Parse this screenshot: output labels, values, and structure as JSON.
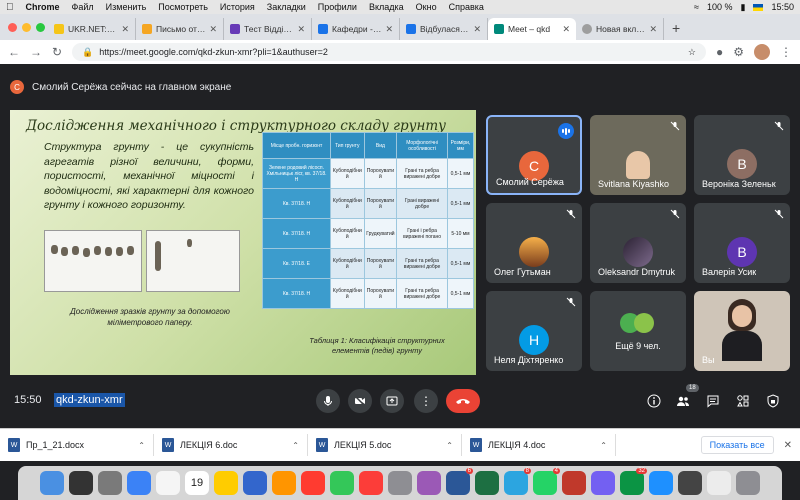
{
  "menubar": {
    "app": "Chrome",
    "items": [
      "Файл",
      "Изменить",
      "Посмотреть",
      "История",
      "Закладки",
      "Профили",
      "Вкладка",
      "Окно",
      "Справка"
    ],
    "battery": "100 %",
    "time": "15:50"
  },
  "tabs": [
    {
      "label": "UKR.NET: Всі н",
      "color": "#f5c518"
    },
    {
      "label": "Письмо отправ",
      "color": "#f5a623"
    },
    {
      "label": "Тест Відділ Хі",
      "color": "#673ab7"
    },
    {
      "label": "Кафедри - БУВ",
      "color": "#1a73e8"
    },
    {
      "label": "Відбулася студ",
      "color": "#1a73e8"
    },
    {
      "label": "Meet – qkd",
      "color": "#00897b",
      "active": true
    },
    {
      "label": "Новая вкладка",
      "color": "#9e9e9e"
    }
  ],
  "address": {
    "url": "https://meet.google.com/qkd-zkun-xmr?pli=1&authuser=2"
  },
  "banner": {
    "initial": "С",
    "text": "Смолий Серёжа сейчас на главном экране"
  },
  "slide": {
    "title": "Дослідження механічного і структурного складу грунту",
    "text": "Структура грунту - це сукупність агрегатів різної величини, форми, пористості, механічної міцності і водоміцності, які характерні для кожного грунту і кожного горизонту.",
    "photo_caption": "Дослідження зразків грунту за допомогою міліметрового паперу.",
    "table_caption": "Таблиця 1: Класифікація структурних елементів (педів) грунту",
    "table": {
      "headers": [
        "Місце пробн. горизонт",
        "Тип грунту",
        "Вид",
        "Морфологічні особливості",
        "Розміри, мм"
      ],
      "rows": [
        [
          "Зелене родовий лісосп. Хмільницьк лісг, кв. 37/18. Н",
          "Кубоподібни й",
          "Порохувати й",
          "Грані та ребра виражені добре",
          "0,5-1 мм"
        ],
        [
          "Кв. 37/18. Н",
          "Кубоподібни й",
          "Порохувати й",
          "Грані виражені добре",
          "0,5-1 мм"
        ],
        [
          "Кв. 37/18. Н",
          "Кубоподібни й",
          "Грудкуватий",
          "Грані і ребра виражені погано",
          "5-10 мм"
        ],
        [
          "Кв. 37/18. Е",
          "Кубоподібни й",
          "Порохувати й",
          "Грані та ребра виражені добре",
          "0,5-1 мм"
        ],
        [
          "Кв. 37/18. Н",
          "Кубоподібни й",
          "Порохувати й",
          "Грані та ребра виражені добре",
          "0,5-1 мм"
        ]
      ]
    }
  },
  "participants": [
    {
      "name": "Смолий Серёжа",
      "initial": "С",
      "color": "#e8673c",
      "speaking": true
    },
    {
      "name": "Svitlana Kiyashko",
      "initial": "",
      "color": "#6d6a5c",
      "video": true
    },
    {
      "name": "Вероніка Зеленьк",
      "initial": "В",
      "color": "#8d6e63"
    },
    {
      "name": "Олег Гутьман",
      "initial": "",
      "color": "#f0a040",
      "photo": true
    },
    {
      "name": "Oleksandr Dmytruk",
      "initial": "",
      "color": "#4a3a5a",
      "photo": true
    },
    {
      "name": "Валерія Усик",
      "initial": "В",
      "color": "#5e35b1"
    },
    {
      "name": "Неля Діхтяренко",
      "initial": "Н",
      "color": "#039be5"
    },
    {
      "name": "Ещё 9 чел.",
      "initial": "",
      "color": "#4caf50",
      "group": true
    },
    {
      "name": "Вы",
      "initial": "",
      "color": "#d9cfc4",
      "video": true,
      "self": true
    }
  ],
  "controls": {
    "time": "15:50",
    "meeting_code": "qkd-zkun-xmr",
    "people_count": "18"
  },
  "downloads": {
    "items": [
      "Пр_1_21.docx",
      "ЛЕКЦІЯ 6.doc",
      "ЛЕКЦІЯ 5.doc",
      "ЛЕКЦІЯ 4.doc"
    ],
    "show_all": "Показать все"
  },
  "dock": {
    "calendar_day": "19",
    "apps": [
      {
        "color": "#4a90e2"
      },
      {
        "color": "#333"
      },
      {
        "color": "#7a7a7a"
      },
      {
        "color": "#3b82f6"
      },
      {
        "color": "#f5f5f5"
      },
      {
        "color": "#e5e5e5"
      },
      {
        "color": "#ffcc00"
      },
      {
        "color": "#3366cc"
      },
      {
        "color": "#ff9500"
      },
      {
        "color": "#ff3b30"
      },
      {
        "color": "#34c759"
      },
      {
        "color": "#fc3d39"
      },
      {
        "color": "#8e8e93"
      },
      {
        "color": "#9b59b6"
      },
      {
        "color": "#2b5797",
        "badge": "6"
      },
      {
        "color": "#1d6f42"
      },
      {
        "color": "#2ca5e0",
        "badge": "8"
      },
      {
        "color": "#25d366",
        "badge": "4"
      },
      {
        "color": "#c0392b"
      },
      {
        "color": "#7360f2"
      },
      {
        "color": "#0b9444",
        "badge": "32"
      },
      {
        "color": "#1e90ff"
      },
      {
        "color": "#444"
      },
      {
        "color": "#ececec"
      },
      {
        "color": "#8e8e93"
      }
    ]
  }
}
